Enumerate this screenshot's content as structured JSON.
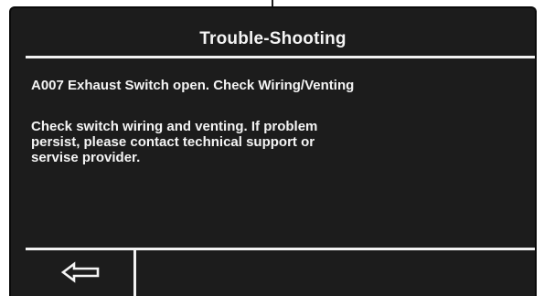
{
  "header": {
    "title": "Trouble-Shooting"
  },
  "fault": {
    "code_line": "A007 Exhaust Switch open. Check Wiring/Venting"
  },
  "message": {
    "lines": [
      "Check switch wiring and venting. If problem",
      "persist, please contact technical support or",
      "servise provider."
    ]
  },
  "footer": {
    "back_icon": "left-arrow-icon"
  },
  "colors": {
    "screen_background": "#1c1c1c",
    "text": "#f4f4f4"
  }
}
